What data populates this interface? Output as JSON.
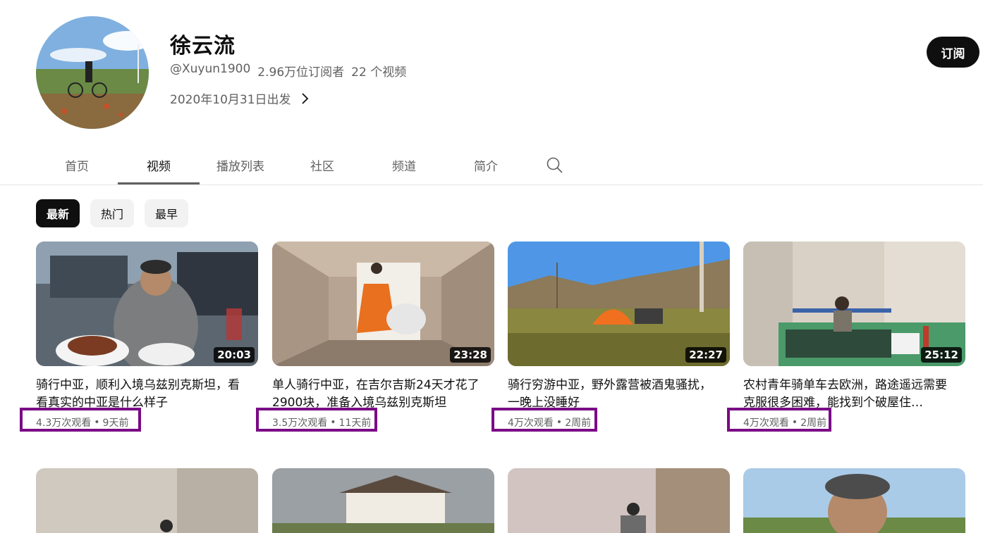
{
  "channel": {
    "name": "徐云流",
    "handle": "@Xuyun1900",
    "subscribers": "2.96万位订阅者",
    "videos_count": "22 个视频",
    "joined": "2020年10月31日出发",
    "subscribe_label": "订阅"
  },
  "tabs": [
    "首页",
    "视频",
    "播放列表",
    "社区",
    "频道",
    "简介"
  ],
  "active_tab": "视频",
  "chips": [
    "最新",
    "热门",
    "最早"
  ],
  "active_chip": "最新",
  "videos": [
    {
      "title": "骑行中亚，顺利入境乌兹别克斯坦，看看真实的中亚是什么样子",
      "views": "4.3万次观看",
      "age": "9天前",
      "duration": "20:03"
    },
    {
      "title": "单人骑行中亚，在吉尔吉斯24天才花了2900块，准备入境乌兹别克斯坦",
      "views": "3.5万次观看",
      "age": "11天前",
      "duration": "23:28"
    },
    {
      "title": "骑行穷游中亚，野外露营被酒鬼骚扰，一晚上没睡好",
      "views": "4万次观看",
      "age": "2周前",
      "duration": "22:27"
    },
    {
      "title": "农村青年骑单车去欧洲，路途遥远需要克服很多困难，能找到个破屋住…",
      "views": "4万次观看",
      "age": "2周前",
      "duration": "25:12"
    }
  ],
  "colors": {
    "highlight": "#7a0a86",
    "active_text": "#0f0f0f",
    "secondary_text": "#606060"
  },
  "icons": [
    "chevron-right-icon",
    "search-icon"
  ]
}
